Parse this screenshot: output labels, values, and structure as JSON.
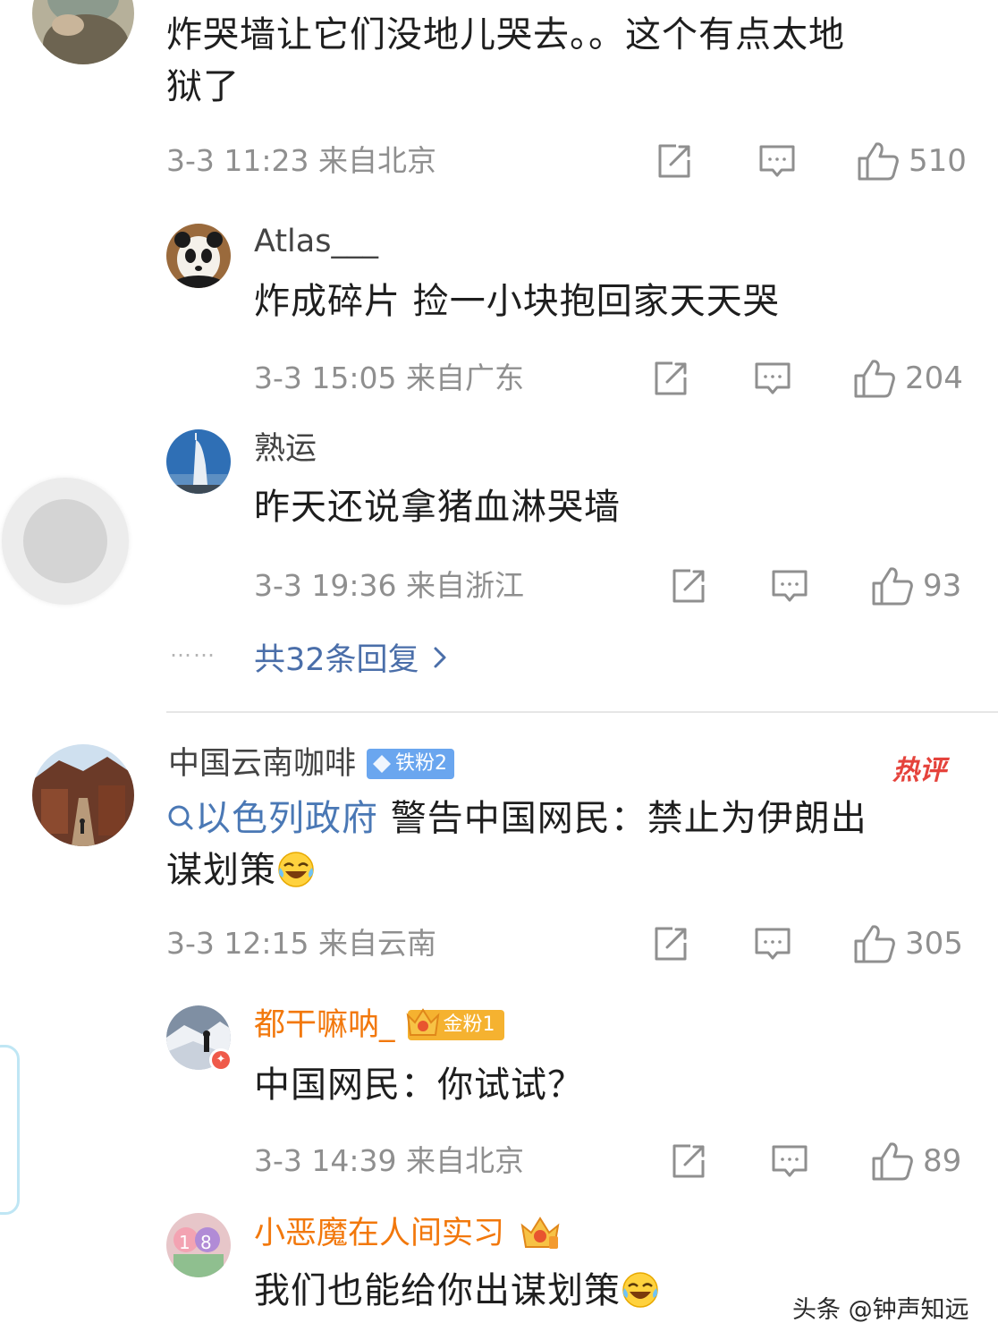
{
  "comments": [
    {
      "id": "c1",
      "text": "炸哭墙让它们没地儿哭去。。这个有点太地狱了",
      "text_line1": "炸哭墙让它们没地儿哭去。。这个有点太地",
      "text_line2": "狱了",
      "meta": "3-3 11:23 来自北京",
      "likes": "510",
      "replies": [
        {
          "username": "Atlas___",
          "text": "炸成碎片 捡一小块抱回家天天哭",
          "meta": "3-3 15:05 来自广东",
          "likes": "204"
        },
        {
          "username": "熟运",
          "text": "昨天还说拿猪血淋哭墙",
          "meta": "3-3 19:36 来自浙江",
          "likes": "93"
        }
      ],
      "more_replies": "共32条回复",
      "more_dots": "……"
    },
    {
      "id": "c2",
      "username": "中国云南咖啡",
      "badge": "铁粉2",
      "hot_tag": "热评",
      "topic": "以色列政府",
      "text_rest_line1": " 警告中国网民：禁止为伊朗出",
      "text_line2": "谋划策",
      "emoji": "laughing-tears",
      "meta": "3-3 12:15 来自云南",
      "likes": "305",
      "replies": [
        {
          "username": "都干嘛呐_",
          "badge": "金粉1",
          "text": "中国网民：你试试？",
          "meta": "3-3 14:39 来自北京",
          "likes": "89"
        },
        {
          "username": "小恶魔在人间实习",
          "text": "我们也能给你出谋划策",
          "emoji": "laughing-tears"
        }
      ]
    }
  ],
  "watermark": "头条 @钟声知远",
  "icons": [
    "share-icon",
    "comment-icon",
    "like-icon"
  ],
  "colors": {
    "meta": "#8f8f8f",
    "link": "#4a6ea9",
    "orange_name": "#f2780c",
    "badge_blue": "#6aa6ef",
    "badge_gold": "#f5b230",
    "hot": "#e5433c"
  }
}
